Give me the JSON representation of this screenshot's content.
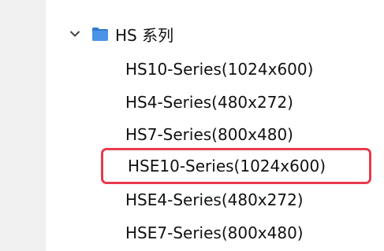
{
  "tree": {
    "group": {
      "label": "HS 系列",
      "expanded": true,
      "icon": "folder-icon",
      "folder_color": "#3b82d6"
    },
    "children": [
      {
        "label": "HS10-Series(1024x600)"
      },
      {
        "label": "HS4-Series(480x272)"
      },
      {
        "label": "HS7-Series(800x480)"
      },
      {
        "label": "HSE10-Series(1024x600)",
        "highlighted": true
      },
      {
        "label": "HSE4-Series(480x272)"
      },
      {
        "label": "HSE7-Series(800x480)"
      }
    ]
  },
  "colors": {
    "highlight_border": "#e83a4f",
    "left_pane": "#f0f0f0"
  }
}
